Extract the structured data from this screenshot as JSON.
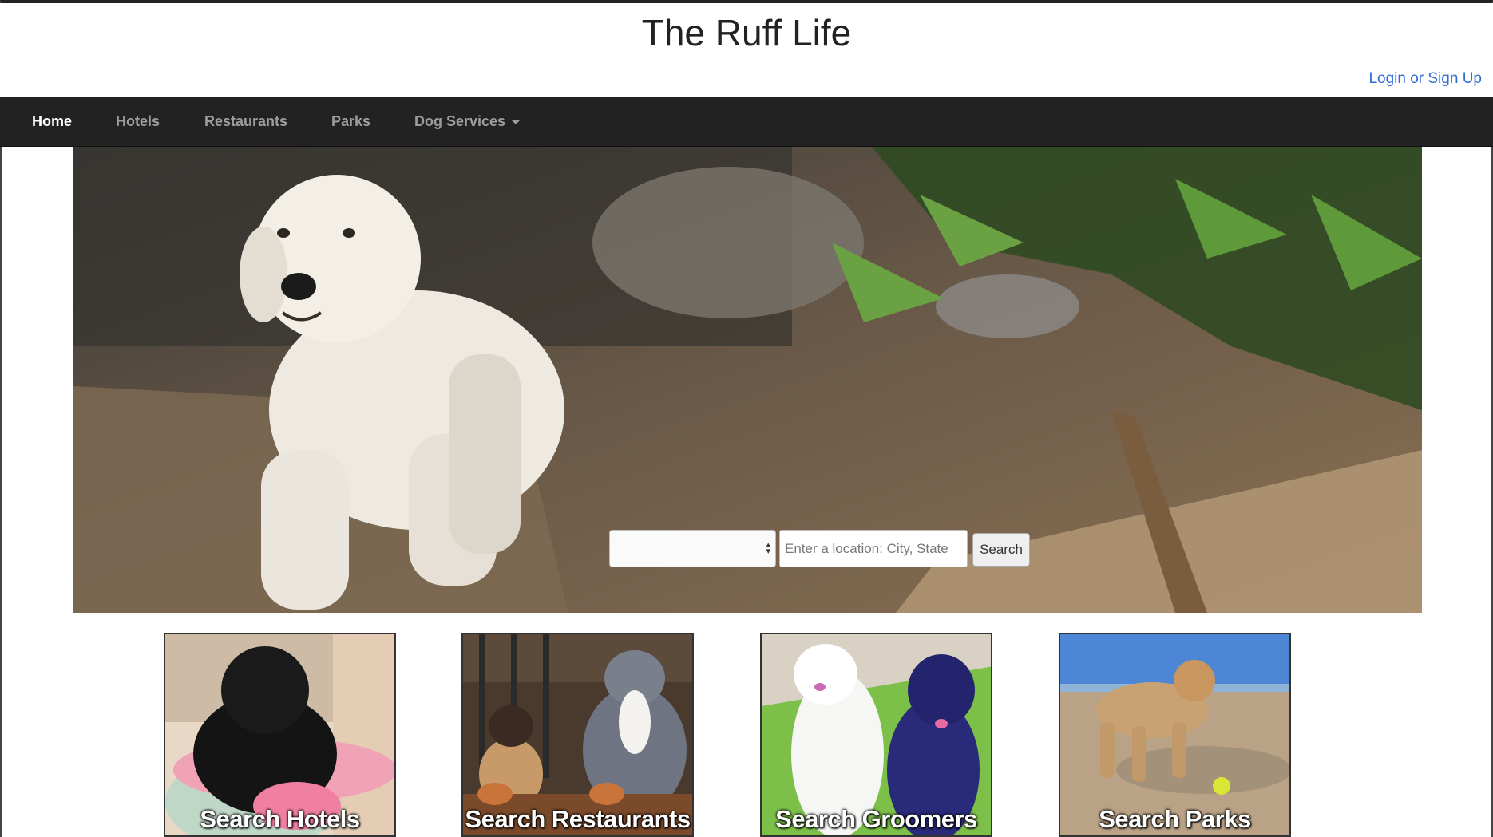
{
  "header": {
    "title": "The Ruff Life",
    "login_label": "Login or Sign Up"
  },
  "nav": {
    "items": [
      {
        "label": "Home",
        "active": true
      },
      {
        "label": "Hotels"
      },
      {
        "label": "Restaurants"
      },
      {
        "label": "Parks"
      },
      {
        "label": "Dog Services",
        "has_dropdown": true
      }
    ]
  },
  "search": {
    "select_value": "",
    "location_placeholder": "Enter a location: City, State",
    "button_label": "Search"
  },
  "tiles": [
    {
      "label": "Search Hotels"
    },
    {
      "label": "Search Restaurants"
    },
    {
      "label": "Search Groomers"
    },
    {
      "label": "Search Parks"
    }
  ],
  "colors": {
    "navbar_bg": "#222222",
    "nav_text": "#9d9d9d",
    "nav_active": "#ffffff",
    "link": "#2f6bd6"
  }
}
